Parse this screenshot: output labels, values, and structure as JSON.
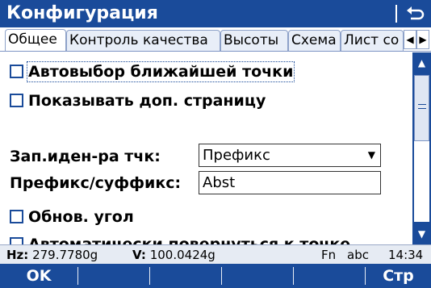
{
  "window": {
    "title": "Конфигурация"
  },
  "tabs": [
    {
      "label": "Общее",
      "active": true
    },
    {
      "label": "Контроль качества",
      "active": false
    },
    {
      "label": "Высоты",
      "active": false
    },
    {
      "label": "Схема",
      "active": false
    },
    {
      "label": "Лист со",
      "active": false
    }
  ],
  "options": {
    "auto_nearest": {
      "label": "Автовыбор ближайшей точки",
      "checked": false
    },
    "show_extra_page": {
      "label": "Показывать доп. страницу",
      "checked": false
    },
    "update_angle": {
      "label": "Обнов. угол",
      "checked": false
    },
    "auto_turn": {
      "label": "Автоматически повернуться к точке",
      "checked": false
    }
  },
  "fields": {
    "point_id": {
      "label": "Зап.иден-ра тчк:",
      "value": "Префикс"
    },
    "prefix_suffix": {
      "label": "Префикс/суффикс:",
      "value": "Abst"
    }
  },
  "status": {
    "hz_label": "Hz:",
    "hz_value": "279.7780g",
    "v_label": "V:",
    "v_value": "100.0424g",
    "mode": "Fn",
    "input_mode": "abc",
    "time": "14:34"
  },
  "softkeys": {
    "f1": "OK",
    "f6": "Стр"
  },
  "colors": {
    "accent": "#1a4b9a",
    "status_bg": "#e6ebf3"
  }
}
